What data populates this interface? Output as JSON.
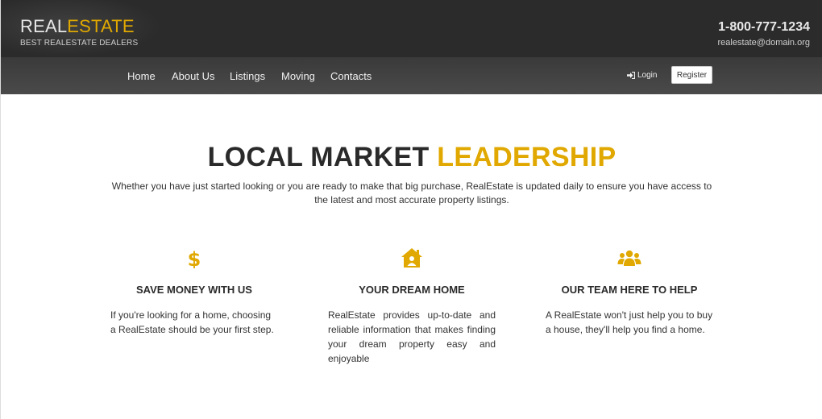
{
  "header": {
    "logo_main": "REAL",
    "logo_accent": "ESTATE",
    "tagline": "BEST REALESTATE DEALERS",
    "phone": "1-800-777-1234",
    "email": "realestate@domain.org"
  },
  "nav": {
    "items": [
      "Home",
      "About Us",
      "Listings",
      "Moving",
      "Contacts"
    ],
    "login_label": "Login",
    "register_label": "Register"
  },
  "hero": {
    "title_main": "LOCAL MARKET",
    "title_accent": "LEADERSHIP",
    "intro": "Whether you have just started looking or you are ready to make that big purchase, RealEstate is updated daily to ensure you have access to the latest and most accurate property listings."
  },
  "features": [
    {
      "icon": "dollar-icon",
      "title": "SAVE MONEY WITH US",
      "text": "If you're looking for a home, choosing a RealEstate should be your first step."
    },
    {
      "icon": "home-user-icon",
      "title": "YOUR DREAM HOME",
      "text": "RealEstate provides up-to-date and reliable information that makes finding your dream property easy and enjoyable"
    },
    {
      "icon": "users-icon",
      "title": "OUR TEAM HERE TO HELP",
      "text": "A RealEstate won't just help you to buy a house, they'll help you find a home."
    }
  ],
  "colors": {
    "accent": "#e0a800",
    "header_bg": "#2b2b2b",
    "nav_bg": "#444444"
  }
}
